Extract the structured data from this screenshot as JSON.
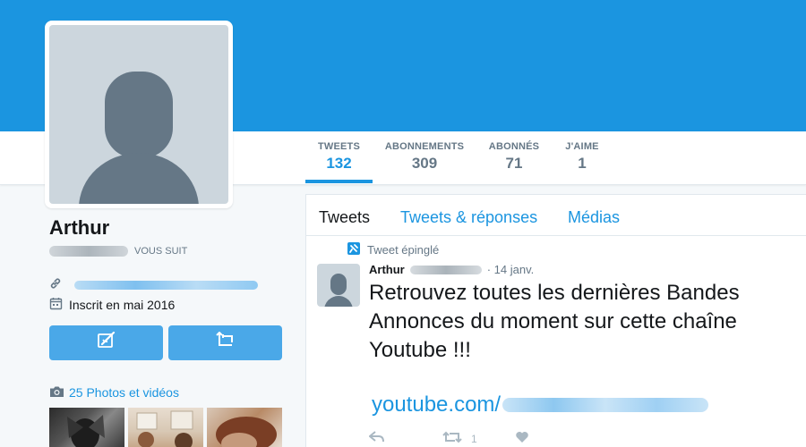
{
  "profile": {
    "name": "Arthur",
    "follows_you": "VOUS SUIT",
    "joined": "Inscrit en mai 2016",
    "media_link": "25 Photos et vidéos"
  },
  "stats": [
    {
      "label": "TWEETS",
      "value": "132",
      "active": true
    },
    {
      "label": "ABONNEMENTS",
      "value": "309",
      "active": false
    },
    {
      "label": "ABONNÉS",
      "value": "71",
      "active": false
    },
    {
      "label": "J'AIME",
      "value": "1",
      "active": false
    }
  ],
  "timeline": {
    "tabs": [
      "Tweets",
      "Tweets & réponses",
      "Médias"
    ],
    "pinned_label": "Tweet épinglé",
    "tweet": {
      "author": "Arthur",
      "date": "· 14 janv.",
      "text": "Retrouvez toutes les dernières Bandes Annonces du moment sur cette chaîne Youtube !!!",
      "link_prefix": "youtube.com/",
      "retweets": "1"
    }
  },
  "colors": {
    "brand_blue": "#1b95e0",
    "button_blue": "#4aa8e8",
    "muted_gray": "#657786"
  },
  "icons": [
    "link-icon",
    "calendar-icon",
    "message-icon",
    "retweet-icon",
    "camera-icon",
    "pin-icon",
    "reply-icon",
    "heart-icon"
  ]
}
